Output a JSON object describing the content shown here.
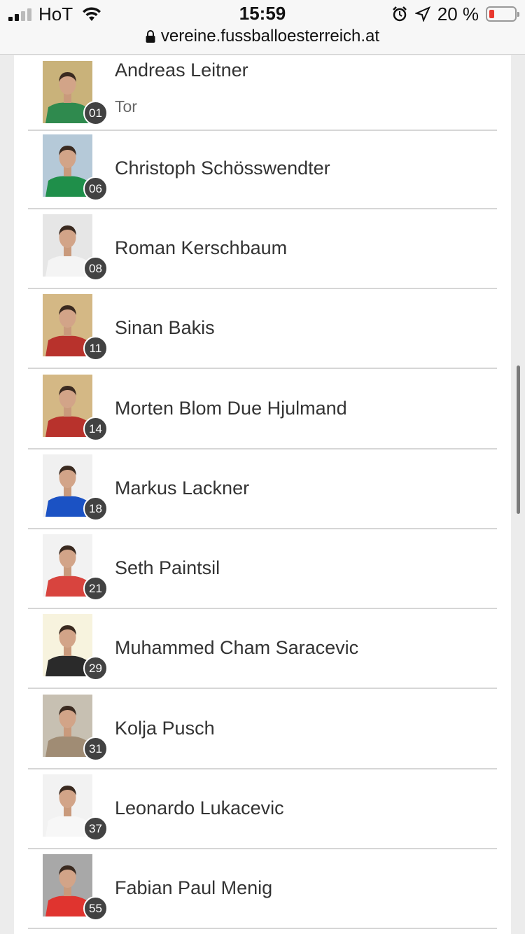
{
  "status": {
    "carrier": "HoT",
    "time": "15:59",
    "battery_pct": "20 %",
    "battery_level": 0.2,
    "url": "vereine.fussballoesterreich.at"
  },
  "players": [
    {
      "name": "Andreas Leitner",
      "role": "Tor",
      "number": "01",
      "photo_bg": "#c9b27a",
      "jersey": "#2f8a4e"
    },
    {
      "name": "Christoph Schösswendter",
      "number": "06",
      "photo_bg": "#b5c9d8",
      "jersey": "#1f8f4a"
    },
    {
      "name": "Roman Kerschbaum",
      "number": "08",
      "photo_bg": "#e6e6e6",
      "jersey": "#f4f4f4"
    },
    {
      "name": "Sinan Bakis",
      "number": "11",
      "photo_bg": "#d4b885",
      "jersey": "#b8322c"
    },
    {
      "name": "Morten Blom Due Hjulmand",
      "number": "14",
      "photo_bg": "#d4b885",
      "jersey": "#b8322c"
    },
    {
      "name": "Markus Lackner",
      "number": "18",
      "photo_bg": "#f0f0f0",
      "jersey": "#1b52c4"
    },
    {
      "name": "Seth Paintsil",
      "number": "21",
      "photo_bg": "#f2f2f2",
      "jersey": "#d8443e"
    },
    {
      "name": "Muhammed Cham Saracevic",
      "number": "29",
      "photo_bg": "#f7f3de",
      "jersey": "#2a2a2a"
    },
    {
      "name": "Kolja Pusch",
      "number": "31",
      "photo_bg": "#c7c0b2",
      "jersey": "#a08c74"
    },
    {
      "name": "Leonardo Lukacevic",
      "number": "37",
      "photo_bg": "#f2f2f2",
      "jersey": "#f7f7f7"
    },
    {
      "name": "Fabian Paul Menig",
      "number": "55",
      "photo_bg": "#a8a8a8",
      "jersey": "#e0342f"
    }
  ]
}
